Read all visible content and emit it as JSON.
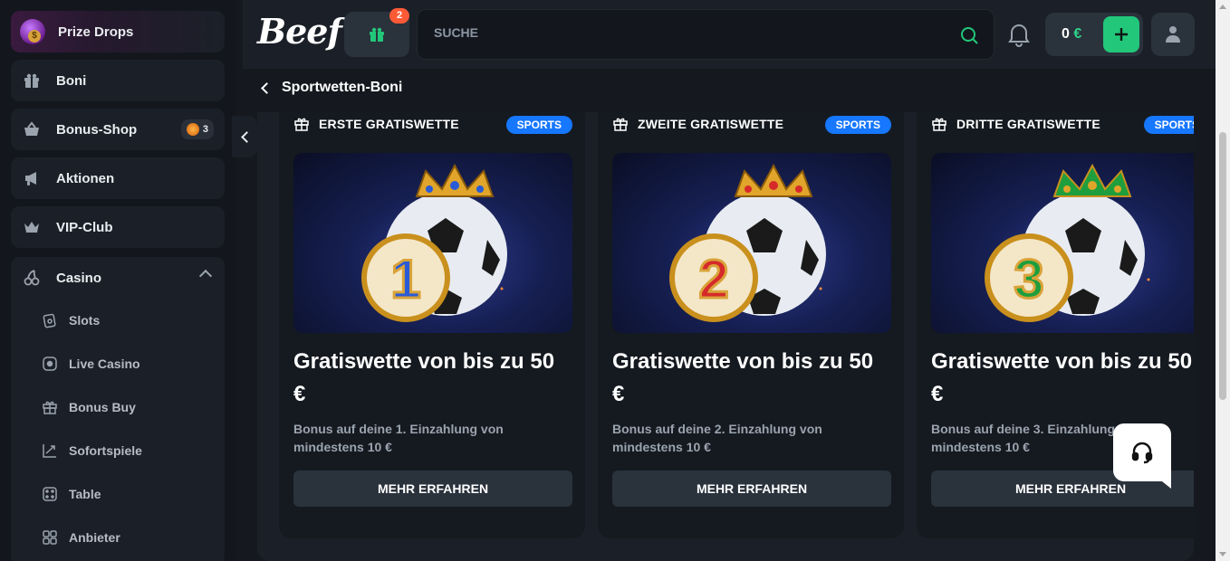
{
  "sidebar": {
    "prize_drops": "Prize Drops",
    "items": [
      {
        "label": "Boni",
        "icon": "gift-icon"
      },
      {
        "label": "Bonus-Shop",
        "icon": "shop-basket-icon",
        "badge": "3"
      },
      {
        "label": "Aktionen",
        "icon": "megaphone-icon"
      },
      {
        "label": "VIP-Club",
        "icon": "crown-icon"
      }
    ],
    "casino": {
      "label": "Casino",
      "icon": "cherries-icon",
      "sub_items": [
        {
          "label": "Slots",
          "icon": "slot-cards-icon"
        },
        {
          "label": "Live Casino",
          "icon": "live-record-icon"
        },
        {
          "label": "Bonus Buy",
          "icon": "gift-icon"
        },
        {
          "label": "Sofortspiele",
          "icon": "chart-arrow-icon"
        },
        {
          "label": "Table",
          "icon": "dice-icon"
        },
        {
          "label": "Anbieter",
          "icon": "grid-icon"
        }
      ]
    }
  },
  "header": {
    "logo": "Beef",
    "gift_badge": "2",
    "search_placeholder": "SUCHE",
    "balance_amount": "0",
    "balance_currency": "€"
  },
  "page": {
    "back_title": "Sportwetten-Boni"
  },
  "cards": [
    {
      "heading": "ERSTE GRATISWETTE",
      "tag": "SPORTS",
      "number": "1",
      "title": "Gratiswette von bis zu 50 €",
      "desc": "Bonus auf deine 1. Einzahlung von mindestens 10 €",
      "button": "MEHR ERFAHREN",
      "accent": "#2a5bd6"
    },
    {
      "heading": "ZWEITE GRATISWETTE",
      "tag": "SPORTS",
      "number": "2",
      "title": "Gratiswette von bis zu 50 €",
      "desc": "Bonus auf deine 2. Einzahlung von mindestens 10 €",
      "button": "MEHR ERFAHREN",
      "accent": "#d62a2a"
    },
    {
      "heading": "DRITTE GRATISWETTE",
      "tag": "SPORTS",
      "number": "3",
      "title": "Gratiswette von bis zu 50 €",
      "desc": "Bonus auf deine 3. Einzahlung von mindestens 10 €",
      "button": "MEHR ERFAHREN",
      "accent": "#1f9e3d"
    }
  ],
  "colors": {
    "accent_green": "#22c77a",
    "sports_tag": "#1677ff",
    "badge_orange": "#ff5a36"
  }
}
